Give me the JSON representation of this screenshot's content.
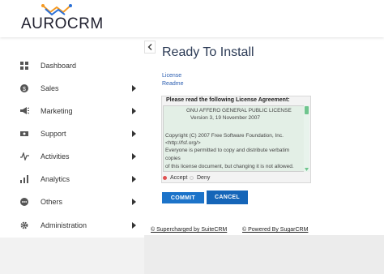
{
  "header": {
    "logo_text": "AUROCRM",
    "colors": {
      "logo_orange": "#f59a23",
      "logo_blue": "#2a6fd6"
    }
  },
  "sidebar": {
    "items": [
      {
        "label": "Dashboard",
        "icon": "dashboard-icon",
        "has_submenu": false
      },
      {
        "label": "Sales",
        "icon": "sales-dollar-icon",
        "has_submenu": true
      },
      {
        "label": "Marketing",
        "icon": "megaphone-icon",
        "has_submenu": true
      },
      {
        "label": "Support",
        "icon": "support-icon",
        "has_submenu": true
      },
      {
        "label": "Activities",
        "icon": "activities-icon",
        "has_submenu": true
      },
      {
        "label": "Analytics",
        "icon": "analytics-chart-icon",
        "has_submenu": true
      },
      {
        "label": "Others",
        "icon": "others-icon",
        "has_submenu": true
      },
      {
        "label": "Administration",
        "icon": "gear-icon",
        "has_submenu": true
      }
    ]
  },
  "main": {
    "title": "Ready To Install",
    "links": [
      "License",
      "Readme"
    ],
    "license_heading": "Please read the following License Agreement:",
    "license_lines": [
      "GNU AFFERO GENERAL PUBLIC LICENSE",
      "Version 3, 19 November 2007",
      "",
      "Copyright (C) 2007 Free Software Foundation, Inc.",
      "<http://fsf.org/>",
      "Everyone is permitted to copy and distribute verbatim",
      "copies",
      "of this license document, but changing it is not allowed."
    ],
    "agreement": {
      "accept_label": "Accept",
      "deny_label": "Deny",
      "selected": "Accept"
    },
    "buttons": {
      "commit": "COMMIT",
      "cancel": "CANCEL"
    },
    "colors": {
      "button": "#1c73c9",
      "title": "#2b3a55",
      "license_bg": "#e3efe6"
    }
  },
  "footer": {
    "supercharged": "© Supercharged by SuiteCRM",
    "powered": "© Powered By SugarCRM"
  }
}
